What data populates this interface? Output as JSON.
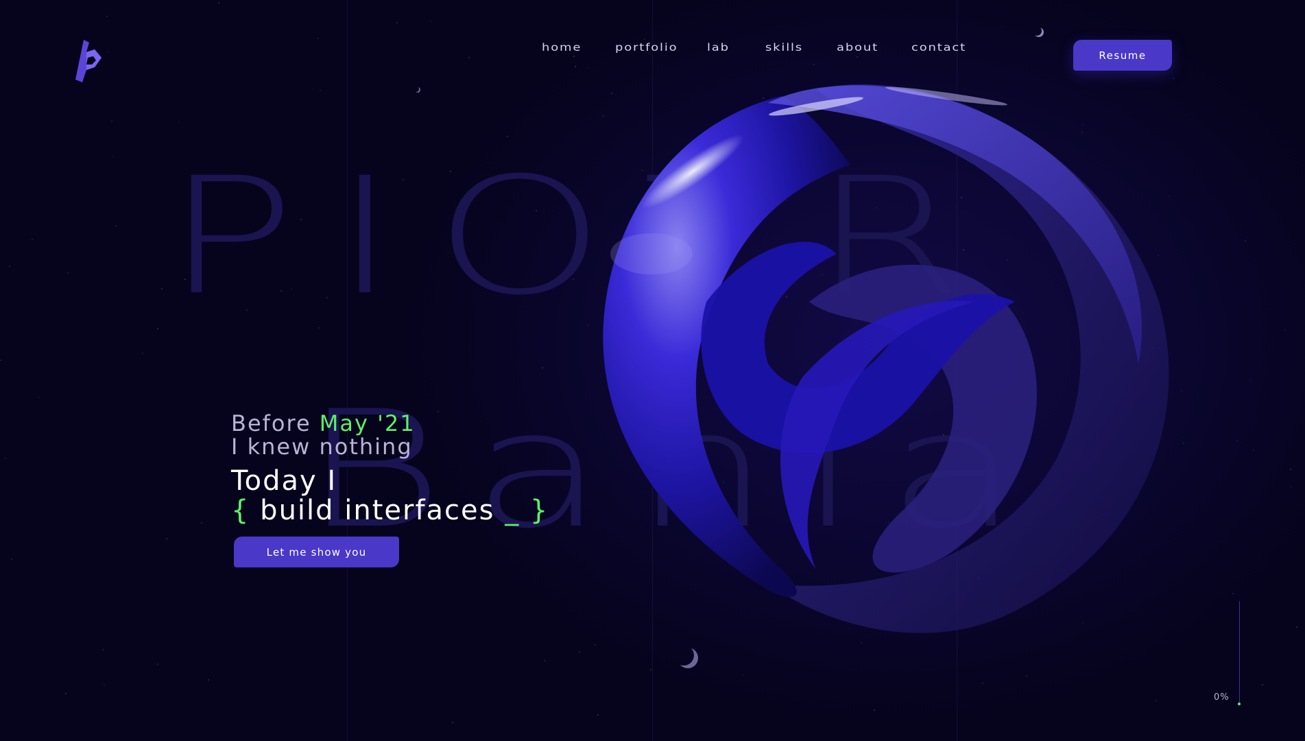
{
  "brand": {
    "logo_icon": "stylized-b-logo-icon",
    "accent": "#4a38c8",
    "highlight": "#5df06a",
    "background": "#06031c"
  },
  "background_name": {
    "first": "PIOTR",
    "last": "Bania"
  },
  "nav": {
    "items": [
      "Home",
      "Portfolio",
      "Lab",
      "Skills",
      "About",
      "Contact"
    ],
    "resume_label": "Resume"
  },
  "hero": {
    "before_prefix": "Before",
    "before_date": "May '21",
    "knew_line": "I knew nothing",
    "today_line": "Today I",
    "brace_open": "{",
    "build_text": "build interfaces",
    "cursor": "_",
    "brace_close": "}",
    "cta_label": "Let me show you"
  },
  "progress": {
    "label": "0%",
    "value": 0
  }
}
